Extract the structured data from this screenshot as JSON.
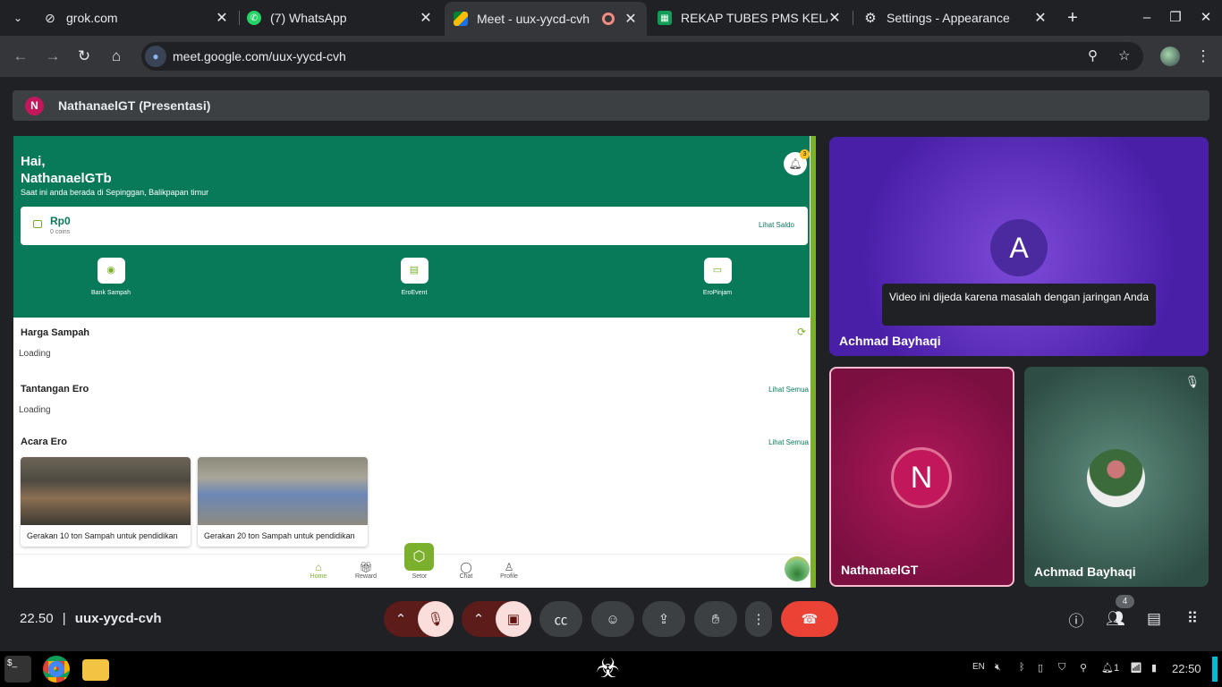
{
  "browser": {
    "tabs": [
      {
        "title": "grok.com",
        "icon": "grok-icon"
      },
      {
        "title": "(7) WhatsApp",
        "icon": "whatsapp-icon"
      },
      {
        "title": "Meet - uux-yycd-cvh",
        "icon": "meet-icon",
        "active": true
      },
      {
        "title": "REKAP TUBES PMS KELAS",
        "icon": "sheets-icon"
      },
      {
        "title": "Settings - Appearance",
        "icon": "settings-icon"
      }
    ],
    "url": "meet.google.com/uux-yycd-cvh"
  },
  "meet": {
    "presenter_initial": "N",
    "presenter_label": "NathanaelGT (Presentasi)",
    "meeting_time": "22.50",
    "meeting_code": "uux-yycd-cvh",
    "people_count": "4",
    "participants": [
      {
        "name": "Achmad Bayhaqi",
        "initial": "A",
        "notice": "Video ini dijeda karena masalah dengan jaringan Anda"
      },
      {
        "name": "NathanaelGT",
        "initial": "N"
      },
      {
        "name": "Achmad Bayhaqi",
        "muted": true
      }
    ],
    "colors": {
      "end_call": "#ea4335",
      "muted_bg": "#f9dedc"
    }
  },
  "app": {
    "greeting": "Hai,",
    "username": "NathanaelGTb",
    "location": "Saat ini anda berada di Sepinggan, Balikpapan timur",
    "notif_count": "3",
    "balance": "Rp0",
    "coins": "0 coins",
    "see_balance": "Lihat Saldo",
    "quick_actions": [
      "Bank Sampah",
      "EroEvent",
      "EroPinjam"
    ],
    "sections": {
      "price_title": "Harga Sampah",
      "price_status": "Loading",
      "challenge_title": "Tantangan Ero",
      "challenge_link": "Lihat Semua",
      "challenge_status": "Loading",
      "events_title": "Acara Ero",
      "events_link": "Lihat Semua"
    },
    "events": [
      "Gerakan 10 ton Sampah untuk pendidikan",
      "Gerakan 20 ton Sampah untuk pendidikan"
    ],
    "nav": {
      "home": "Home",
      "reward": "Reward",
      "setor": "Setor",
      "chat": "Chat",
      "profile": "Profile"
    },
    "colors": {
      "primary": "#087a5a",
      "accent": "#7bb02d"
    }
  },
  "taskbar": {
    "lang": "EN",
    "time": "22:50",
    "notif": "1"
  }
}
